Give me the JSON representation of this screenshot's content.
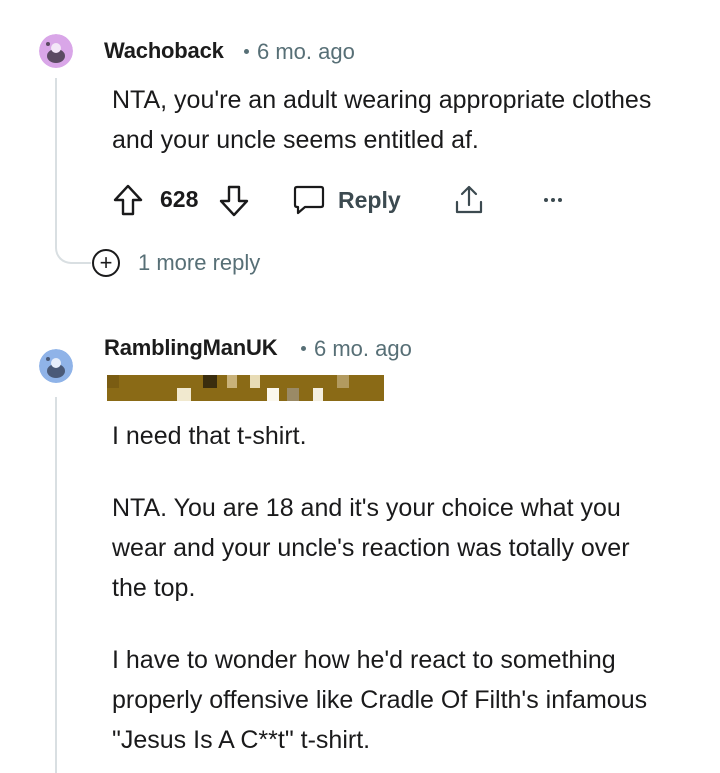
{
  "comments": [
    {
      "username": "Wachoback",
      "time": "6 mo. ago",
      "paragraphs": [
        "NTA, you're an adult wearing appropriate clothes and your uncle seems entitled af."
      ],
      "votes": "628",
      "reply_label": "Reply",
      "more_label": "•••",
      "more_replies": "1 more reply",
      "avatar_color": "#d9a6e8"
    },
    {
      "username": "RamblingManUK",
      "time": "6 mo. ago",
      "paragraphs": [
        "I need that t-shirt.",
        "NTA. You are 18 and it's your choice what you wear and your uncle's reaction was totally over the top.",
        "I have to wonder how he'd react to something properly offensive like Cradle Of Filth's infamous \"Jesus Is A C**t\" t-shirt."
      ],
      "avatar_color": "#8fb3e8"
    }
  ],
  "icons": {
    "upvote": "arrow-up-icon",
    "downvote": "arrow-down-icon",
    "reply": "comment-bubble-icon",
    "share": "share-icon",
    "more": "ellipsis-icon",
    "expand": "plus-circle-icon"
  },
  "colors": {
    "text": "#1a1a1b",
    "meta": "#576f76",
    "thread_line": "#d9dfe2",
    "flair_background": "#8a6a16"
  }
}
